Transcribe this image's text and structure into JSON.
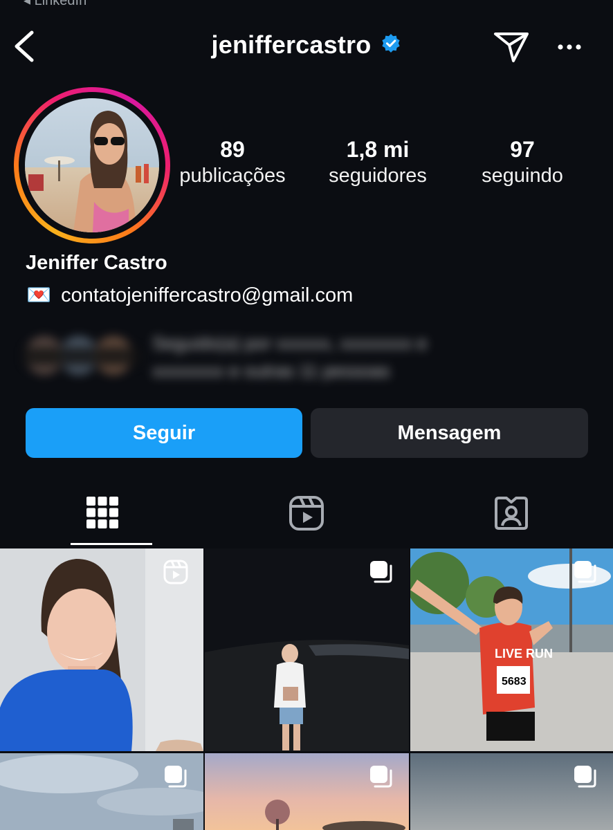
{
  "status_bar": {
    "back_app_label": "◂ LinkedIn"
  },
  "header": {
    "username": "jeniffercastro",
    "verified": true
  },
  "profile": {
    "stats": [
      {
        "value": "89",
        "label": "publicações"
      },
      {
        "value": "1,8 mi",
        "label": "seguidores"
      },
      {
        "value": "97",
        "label": "seguindo"
      }
    ],
    "full_name": "Jeniffer Castro",
    "email_emoji": "💌",
    "email": "contatojeniffercastro@gmail.com",
    "followed_by_text_line1": "Seguido(a) por xxxxxx, xxxxxxxx e",
    "followed_by_text_line2": "xxxxxxxx e outras 11 pessoas"
  },
  "actions": {
    "follow_label": "Seguir",
    "message_label": "Mensagem"
  },
  "colors": {
    "accent": "#1a9ff8",
    "background": "#0b0d12",
    "secondary_button": "#24262c",
    "verified": "#1d9bf0"
  },
  "tabs": [
    {
      "name": "grid-icon",
      "active": true
    },
    {
      "name": "reels-icon",
      "active": false
    },
    {
      "name": "tagged-icon",
      "active": false
    }
  ],
  "grid_tiles": [
    {
      "type": "reel",
      "icon": "reels-icon"
    },
    {
      "type": "carousel",
      "icon": "carousel-icon"
    },
    {
      "type": "carousel",
      "icon": "carousel-icon",
      "bib_number": "5683",
      "shirt_text": "LIVE RUN"
    },
    {
      "type": "carousel",
      "icon": "carousel-icon"
    },
    {
      "type": "carousel",
      "icon": "carousel-icon"
    },
    {
      "type": "carousel",
      "icon": "carousel-icon"
    }
  ]
}
